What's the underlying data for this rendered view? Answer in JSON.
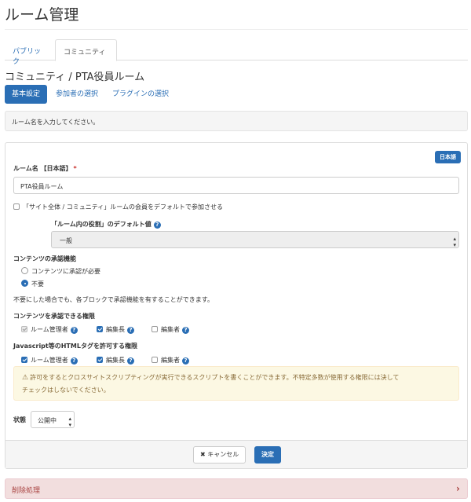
{
  "page": {
    "title": "ルーム管理"
  },
  "tabs": [
    {
      "label": "パブリック",
      "active": false
    },
    {
      "label": "コミュニティ",
      "active": true
    }
  ],
  "room_heading": "コミュニティ / PTA役員ルーム",
  "pills": [
    {
      "label": "基本設定",
      "active": true
    },
    {
      "label": "参加者の選択",
      "active": false
    },
    {
      "label": "プラグインの選択",
      "active": false
    }
  ],
  "hint": "ルーム名を入力してください。",
  "form": {
    "language_badge": "日本語",
    "room_name": {
      "label": "ルーム名 【日本語】",
      "required_mark": "*",
      "value": "PTA役員ルーム"
    },
    "default_join": {
      "label": "「サイト全体 / コミュニティ」ルームの会員をデフォルトで参加させる",
      "checked": false
    },
    "default_role": {
      "label": "「ルーム内の役割」のデフォルト値",
      "value": "一般"
    },
    "approval": {
      "label": "コンテンツの承認機能",
      "options": [
        {
          "label": "コンテンツに承認が必要",
          "selected": false
        },
        {
          "label": "不要",
          "selected": true
        }
      ],
      "note": "不要にした場合でも、各ブロックで承認機能を有することができます。"
    },
    "approve_permission": {
      "label": "コンテンツを承認できる権限",
      "roles": [
        {
          "label": "ルーム管理者",
          "checked": true,
          "disabled": true
        },
        {
          "label": "編集長",
          "checked": true,
          "disabled": false
        },
        {
          "label": "編集者",
          "checked": false,
          "disabled": false
        }
      ]
    },
    "html_permission": {
      "label": "Javascript等のHTMLタグを許可する権限",
      "roles": [
        {
          "label": "ルーム管理者",
          "checked": true,
          "disabled": false
        },
        {
          "label": "編集長",
          "checked": true,
          "disabled": false
        },
        {
          "label": "編集者",
          "checked": false,
          "disabled": false
        }
      ],
      "warning_line1": "許可をするとクロスサイトスクリプティングが実行できるスクリプトを書くことができます。不特定多数が使用する権限には決して",
      "warning_line2": "チェックはしないでください。"
    },
    "status": {
      "label": "状態",
      "value": "公開中"
    }
  },
  "buttons": {
    "cancel": "キャンセル",
    "submit": "決定"
  },
  "danger": {
    "label": "削除処理"
  },
  "colors": {
    "primary": "#2a6eb5",
    "danger_bg": "#f2dede",
    "warning_bg": "#fcf8e3"
  }
}
